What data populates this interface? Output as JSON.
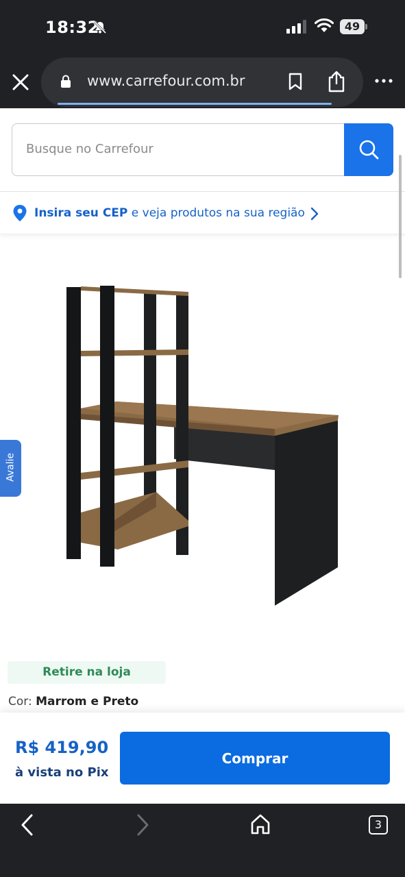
{
  "status_bar": {
    "time": "18:32",
    "battery": "49",
    "icons": [
      "bell-muted-icon",
      "signal-icon",
      "wifi-icon",
      "battery-icon"
    ]
  },
  "browser": {
    "url": "www.carrefour.com.br",
    "icons": [
      "close-icon",
      "lock-icon",
      "bookmark-icon",
      "share-icon",
      "more-icon"
    ]
  },
  "search": {
    "placeholder": "Busque no Carrefour",
    "value": ""
  },
  "cep": {
    "link_text": "Insira seu CEP",
    "rest_text": " e veja produtos na sua região"
  },
  "side_tab": {
    "label": "Avalie"
  },
  "product": {
    "pickup_badge": "Retire na loja",
    "color_label": "Cor: ",
    "color_value": "Marrom e Preto"
  },
  "purchase": {
    "price": "R$ 419,90",
    "price_note": "à vista no Pix",
    "buy_label": "Comprar"
  },
  "toolbar": {
    "tabs_count": "3"
  },
  "colors": {
    "carrefour_blue": "#1a73e8",
    "price_blue": "#1662c7",
    "pickup_green": "#2e8b57",
    "chrome_dark": "#1f2125"
  }
}
